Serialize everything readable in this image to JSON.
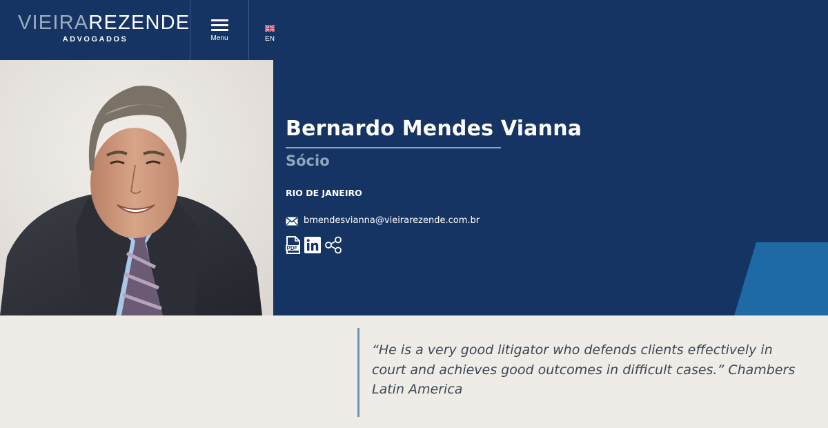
{
  "header": {
    "logo": {
      "part1": "VIEIRA",
      "part2": "REZENDE",
      "sub": "ADVOGADOS"
    },
    "menu_label": "Menu",
    "language": {
      "label": "EN",
      "flag_icon": "uk-flag-icon"
    }
  },
  "profile": {
    "name": "Bernardo Mendes Vianna",
    "role": "Sócio",
    "city": "RIO DE JANEIRO",
    "email": "bmendesvianna@vieirarezende.com.br",
    "icons": [
      "envelope-icon",
      "pdf-icon",
      "linkedin-icon",
      "share-icon"
    ],
    "photo_icon": "portrait-photo"
  },
  "quote": {
    "text": "“He is a very good litigator who defends clients effectively in court and achieves good outcomes in difficult cases.” Chambers Latin America"
  },
  "colors": {
    "navy": "#163463",
    "accent_blue": "#1f6aa5",
    "light_steel": "#8fa7bd",
    "background": "#efece7"
  }
}
